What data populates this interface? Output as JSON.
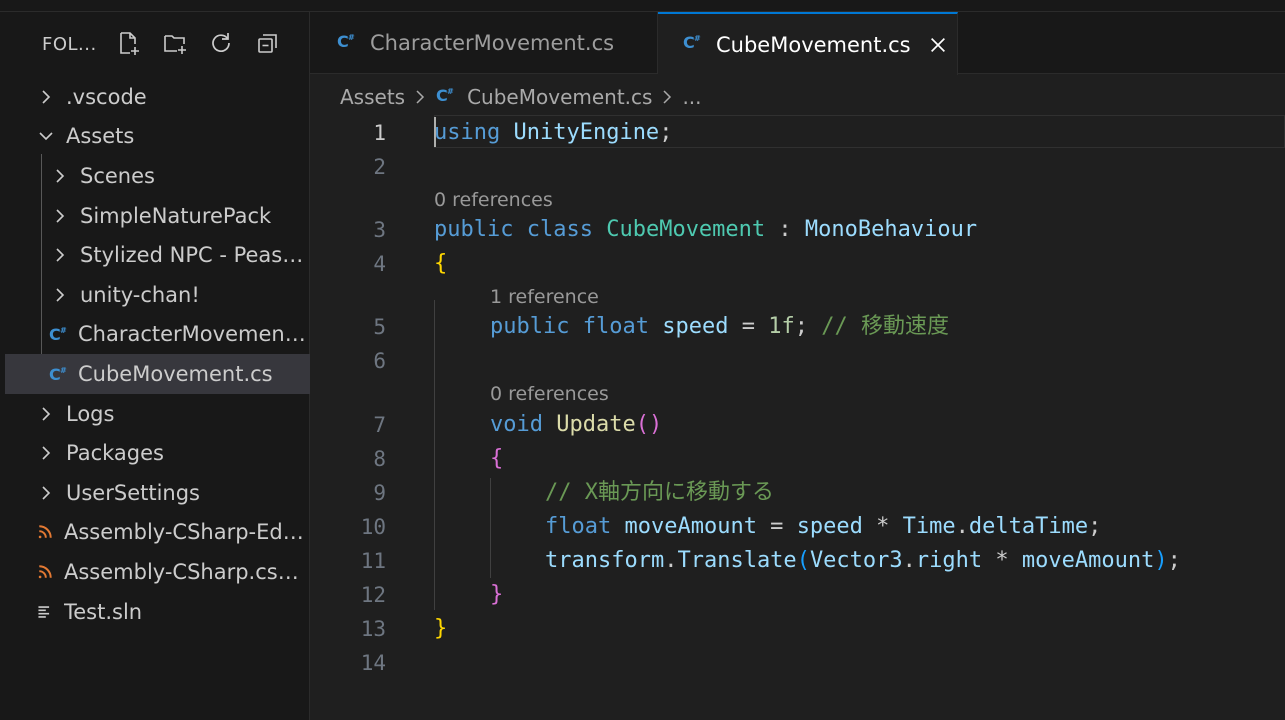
{
  "explorer": {
    "title": "FOL...",
    "actions": [
      "new-file-icon",
      "new-folder-icon",
      "refresh-icon",
      "collapse-all-icon"
    ],
    "items": [
      {
        "label": ".vscode",
        "type": "folder",
        "expanded": false,
        "depth": 0
      },
      {
        "label": "Assets",
        "type": "folder",
        "expanded": true,
        "depth": 0
      },
      {
        "label": "Scenes",
        "type": "folder",
        "expanded": false,
        "depth": 1
      },
      {
        "label": "SimpleNaturePack",
        "type": "folder",
        "expanded": false,
        "depth": 1
      },
      {
        "label": "Stylized NPC - Peasa...",
        "type": "folder",
        "expanded": false,
        "depth": 1
      },
      {
        "label": "unity-chan!",
        "type": "folder",
        "expanded": false,
        "depth": 1
      },
      {
        "label": "CharacterMovement...",
        "type": "csharp",
        "depth": 1
      },
      {
        "label": "CubeMovement.cs",
        "type": "csharp",
        "depth": 1,
        "selected": true
      },
      {
        "label": "Logs",
        "type": "folder",
        "expanded": false,
        "depth": 0
      },
      {
        "label": "Packages",
        "type": "folder",
        "expanded": false,
        "depth": 0
      },
      {
        "label": "UserSettings",
        "type": "folder",
        "expanded": false,
        "depth": 0
      },
      {
        "label": "Assembly-CSharp-Edi...",
        "type": "rss",
        "depth": 0
      },
      {
        "label": "Assembly-CSharp.csp...",
        "type": "rss",
        "depth": 0
      },
      {
        "label": "Test.sln",
        "type": "lines",
        "depth": 0
      }
    ]
  },
  "tabs": [
    {
      "label": "CharacterMovement.cs",
      "active": false
    },
    {
      "label": "CubeMovement.cs",
      "active": true
    }
  ],
  "breadcrumbs": {
    "folder": "Assets",
    "file": "CubeMovement.cs",
    "more": "..."
  },
  "editor": {
    "line_numbers": [
      "1",
      "2",
      "3",
      "4",
      "5",
      "6",
      "7",
      "8",
      "9",
      "10",
      "11",
      "12",
      "13",
      "14"
    ],
    "current_line": "1",
    "code_lens": [
      "0 references",
      "1 reference",
      "0 references"
    ],
    "lines": {
      "l1": [
        "using",
        " ",
        "UnityEngine",
        ";"
      ],
      "l3": [
        "public",
        " ",
        "class",
        " ",
        "CubeMovement",
        " : ",
        "MonoBehaviour"
      ],
      "l4": [
        "{"
      ],
      "l5": [
        "public",
        " ",
        "float",
        " ",
        "speed",
        " = ",
        "1f",
        ";",
        " ",
        "// 移動速度"
      ],
      "l7": [
        "void",
        " ",
        "Update",
        "(",
        ")"
      ],
      "l8": [
        "{"
      ],
      "l9": [
        "// X軸方向に移動する"
      ],
      "l10": [
        "float",
        " ",
        "moveAmount",
        " = ",
        "speed",
        " * ",
        "Time",
        ".",
        "deltaTime",
        ";"
      ],
      "l11": [
        "transform",
        ".",
        "Translate",
        "(",
        "Vector3",
        ".",
        "right",
        " * ",
        "moveAmount",
        ")",
        ";"
      ],
      "l12": [
        "}"
      ],
      "l13": [
        "}"
      ]
    }
  },
  "colors": {
    "accent": "#0078d4",
    "keyword": "#569cd6",
    "type": "#4ec9b0",
    "variable": "#9cdcfe",
    "function": "#dcdcaa",
    "number": "#b5cea8",
    "comment": "#6a9955",
    "csharp_icon": "#3d8fd1",
    "rss_icon": "#e37933"
  }
}
